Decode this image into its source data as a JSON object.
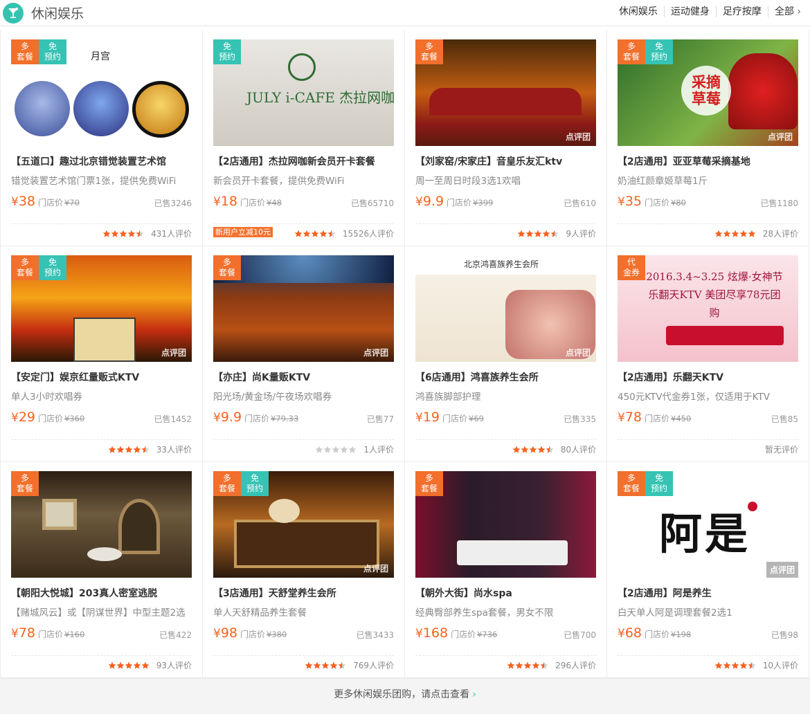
{
  "header": {
    "title": "休闲娱乐",
    "nav": [
      "休闲娱乐",
      "运动健身",
      "足疗按摩",
      "全部"
    ]
  },
  "colors": {
    "accent": "#36c3b4",
    "price": "#f76120",
    "tag_orange": "#f26f2c"
  },
  "deals": [
    {
      "tags": [
        "多套餐",
        "免预约"
      ],
      "image_text": "月宫",
      "name": "【五道口】趣过北京错觉装置艺术馆",
      "desc": "错觉装置艺术馆门票1张，提供免费WiFi",
      "price": "38",
      "store_label": "门店价",
      "orig": "¥70",
      "sold": "已售3246",
      "rating": 4.5,
      "reviews": "431人评价"
    },
    {
      "tags": [
        "免预约"
      ],
      "image_text": "JULY i-CAFE 杰拉网咖",
      "name": "【2店通用】杰拉网咖新会员开卡套餐",
      "desc": "新会员开卡套餐，提供免费WiFi",
      "price": "18",
      "store_label": "门店价",
      "orig": "¥48",
      "sold": "已售65710",
      "rating": 4.5,
      "reviews": "15526人评价",
      "promo": "新用户立减10元"
    },
    {
      "tags": [
        "多套餐"
      ],
      "watermark": "点评团",
      "name": "【刘家窑/宋家庄】音皇乐友汇ktv",
      "desc": "周一至周日时段3选1欢唱",
      "price": "9.9",
      "store_label": "门店价",
      "orig": "¥399",
      "sold": "已售610",
      "rating": 4.5,
      "reviews": "9人评价"
    },
    {
      "tags": [
        "多套餐",
        "免预约"
      ],
      "image_text": "采摘草莓",
      "watermark": "点评团",
      "name": "【2店通用】亚亚草莓采摘基地",
      "desc": "奶油红颜章姬草莓1斤",
      "price": "35",
      "store_label": "门店价",
      "orig": "¥80",
      "sold": "已售1180",
      "rating": 5,
      "reviews": "28人评价"
    },
    {
      "tags": [
        "多套餐",
        "免预约"
      ],
      "watermark": "点评团",
      "name": "【安定门】娱京红量贩式KTV",
      "desc": "单人3小时欢唱券",
      "price": "29",
      "store_label": "门店价",
      "orig": "¥360",
      "sold": "已售1452",
      "rating": 4.5,
      "reviews": "33人评价"
    },
    {
      "tags": [
        "多套餐"
      ],
      "watermark": "点评团",
      "name": "【亦庄】尚K量贩KTV",
      "desc": "阳光场/黄金场/午夜场欢唱券",
      "price": "9.9",
      "store_label": "门店价",
      "orig": "¥79.33",
      "sold": "已售77",
      "rating": 0,
      "reviews": "1人评价"
    },
    {
      "tags": [],
      "image_text": "北京鸿喜族养生会所",
      "watermark": "点评团",
      "name": "【6店通用】鸿喜族养生会所",
      "desc": "鸿喜族脚部护理",
      "price": "19",
      "store_label": "门店价",
      "orig": "¥69",
      "sold": "已售335",
      "rating": 4.5,
      "reviews": "80人评价"
    },
    {
      "tags": [
        "代金券"
      ],
      "image_text": "2016.3.4~3.25 炫爆·女神节 乐翻天KTV 美团尽享78元团购",
      "name": "【2店通用】乐翻天KTV",
      "desc": "450元KTV代金券1张，仅适用于KTV",
      "price": "78",
      "store_label": "门店价",
      "orig": "¥450",
      "sold": "已售85",
      "rating": null,
      "reviews": "暂无评价"
    },
    {
      "tags": [
        "多套餐"
      ],
      "name": "【朝阳大悦城】203真人密室逃脱",
      "desc": "【赌城风云】或【阴谋世界】中型主题2选",
      "price": "78",
      "store_label": "门店价",
      "orig": "¥160",
      "sold": "已售422",
      "rating": 5,
      "reviews": "93人评价"
    },
    {
      "tags": [
        "多套餐",
        "免预约"
      ],
      "watermark": "点评团",
      "name": "【3店通用】天舒堂养生会所",
      "desc": "单人天舒精品养生套餐",
      "price": "98",
      "store_label": "门店价",
      "orig": "¥380",
      "sold": "已售3433",
      "rating": 4.5,
      "reviews": "769人评价"
    },
    {
      "tags": [
        "多套餐"
      ],
      "name": "【朝外大街】尚水spa",
      "desc": "经典臀部养生spa套餐，男女不限",
      "price": "168",
      "store_label": "门店价",
      "orig": "¥736",
      "sold": "已售700",
      "rating": 4.5,
      "reviews": "296人评价"
    },
    {
      "tags": [
        "多套餐",
        "免预约"
      ],
      "image_text": "阿是",
      "watermark": "点评团",
      "name": "【2店通用】阿是养生",
      "desc": "白天单人阿是调理套餐2选1",
      "price": "68",
      "store_label": "门店价",
      "orig": "¥198",
      "sold": "已售98",
      "rating": 4.5,
      "reviews": "10人评价"
    }
  ],
  "footer": {
    "text": "更多休闲娱乐团购，请点击查看"
  }
}
